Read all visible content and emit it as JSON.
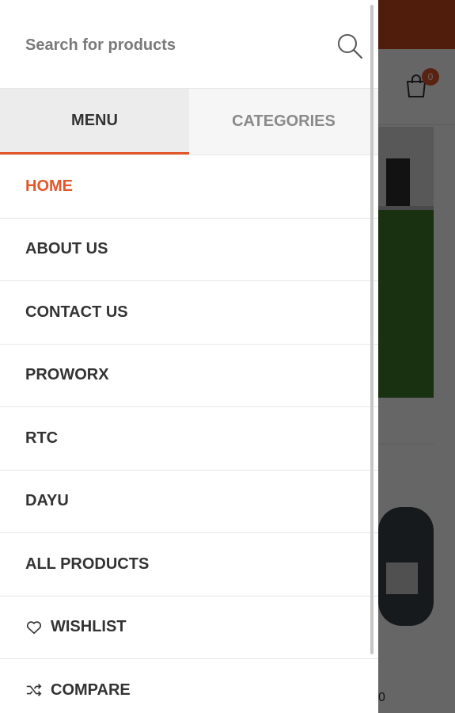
{
  "search": {
    "placeholder": "Search for products"
  },
  "tabs": [
    {
      "label": "MENU",
      "active": true
    },
    {
      "label": "CATEGORIES",
      "active": false
    }
  ],
  "menu": {
    "items": [
      {
        "label": "HOME",
        "active": true
      },
      {
        "label": "ABOUT US"
      },
      {
        "label": "CONTACT US"
      },
      {
        "label": "PROWORX"
      },
      {
        "label": "RTC"
      },
      {
        "label": "DAYU"
      },
      {
        "label": "ALL PRODUCTS"
      },
      {
        "label": "WISHLIST",
        "icon": "heart-icon"
      },
      {
        "label": "COMPARE",
        "icon": "shuffle-icon"
      }
    ]
  },
  "background": {
    "cart_count": "0",
    "price_fragment": "0"
  },
  "colors": {
    "accent": "#e2572b",
    "topbar": "#c8461c"
  }
}
